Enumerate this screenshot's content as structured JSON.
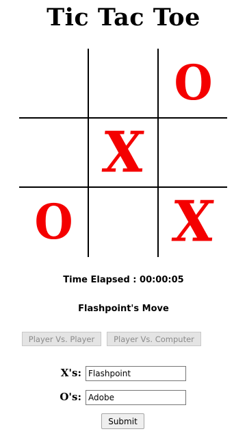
{
  "title": "Tic Tac Toe",
  "board": {
    "cells": [
      "",
      "",
      "O",
      "",
      "X",
      "",
      "O",
      "",
      "X"
    ],
    "mark_color": "#f40000"
  },
  "status": {
    "time_elapsed": "Time Elapsed : 00:00:05",
    "turn": "Flashpoint's Move"
  },
  "modes": {
    "pvp_label": "Player Vs. Player",
    "pvc_label": "Player Vs. Computer"
  },
  "players": {
    "x_label": "X's:",
    "x_name": "Flashpoint",
    "o_label": "O's:",
    "o_name": "Adobe"
  },
  "submit_label": "Submit"
}
